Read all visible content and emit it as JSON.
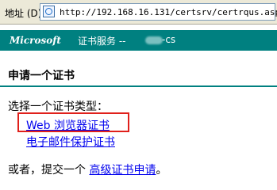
{
  "address_bar": {
    "label": "地址 (D)",
    "url": "http://192.168.16.131/certsrv/certrqus.asp"
  },
  "banner": {
    "brand": "Microsoft",
    "service": "证书服务 --",
    "host": "-cs"
  },
  "page": {
    "heading": "申请一个证书",
    "prompt": "选择一个证书类型：",
    "links": [
      "Web 浏览器证书",
      "电子邮件保护证书"
    ],
    "alt_prefix": "或者，提交一个",
    "alt_link": "高级证书申请",
    "alt_suffix": "。"
  },
  "colors": {
    "banner": "#008080",
    "link": "#0000ee",
    "highlight": "#e0201b"
  }
}
